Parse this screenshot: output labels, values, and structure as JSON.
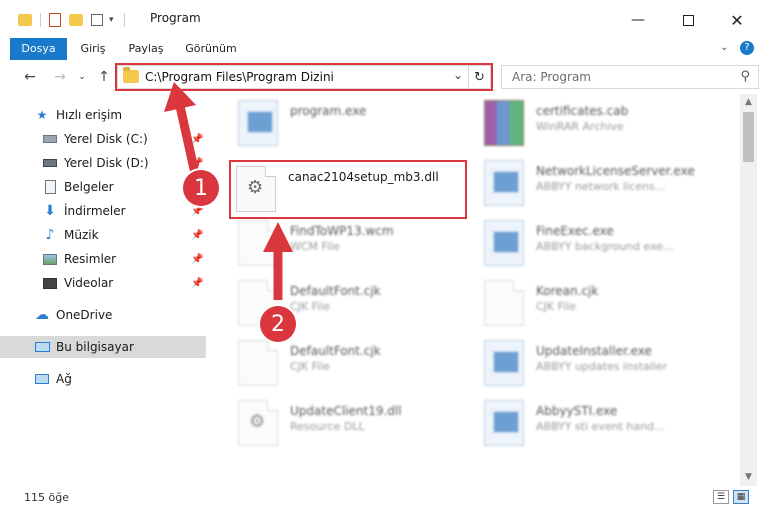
{
  "window": {
    "title": "Program",
    "minimize_icon": "minimize-icon",
    "maximize_icon": "maximize-icon",
    "close_icon": "close-icon"
  },
  "ribbon": {
    "tabs": [
      {
        "label": "Dosya",
        "active": true
      },
      {
        "label": "Giriş"
      },
      {
        "label": "Paylaş"
      },
      {
        "label": "Görünüm"
      }
    ]
  },
  "address": {
    "path": "C:\\Program Files\\Program Dizini"
  },
  "search": {
    "placeholder": "Ara: Program"
  },
  "sidebar": {
    "items": [
      {
        "label": "Hızlı erişim",
        "icon": "star-icon"
      },
      {
        "label": "Yerel Disk (C:)",
        "icon": "drive-icon",
        "pinned": true
      },
      {
        "label": "Yerel Disk (D:)",
        "icon": "drive-icon",
        "pinned": true
      },
      {
        "label": "Belgeler",
        "icon": "documents-icon",
        "pinned": true
      },
      {
        "label": "İndirmeler",
        "icon": "download-icon",
        "pinned": true
      },
      {
        "label": "Müzik",
        "icon": "music-icon",
        "pinned": true
      },
      {
        "label": "Resimler",
        "icon": "pictures-icon",
        "pinned": true
      },
      {
        "label": "Videolar",
        "icon": "video-icon",
        "pinned": true
      },
      {
        "label": "OneDrive",
        "icon": "cloud-icon"
      },
      {
        "label": "Bu bilgisayar",
        "icon": "computer-icon",
        "selected": true
      },
      {
        "label": "Ağ",
        "icon": "network-icon"
      }
    ]
  },
  "files": [
    {
      "name": "program.exe",
      "type": "",
      "kind": "exe"
    },
    {
      "name": "certificates.cab",
      "type": "WinRAR Archive",
      "kind": "rar"
    },
    {
      "name": "canac2104setup_mb3.dll",
      "type": "",
      "kind": "dll"
    },
    {
      "name": "NetworkLicenseServer.exe",
      "type": "ABBYY network licens...",
      "kind": "exe"
    },
    {
      "name": "FindToWP13.wcm",
      "type": "WCM File",
      "kind": "txt"
    },
    {
      "name": "FineExec.exe",
      "type": "ABBYY background exe...",
      "kind": "exe"
    },
    {
      "name": "DefaultFont.cjk",
      "type": "CJK File",
      "kind": "txt"
    },
    {
      "name": "Korean.cjk",
      "type": "CJK File",
      "kind": "txt"
    },
    {
      "name": "DefaultFont.cjk",
      "type": "CJK File",
      "kind": "txt"
    },
    {
      "name": "UpdateInstaller.exe",
      "type": "ABBYY updates installer",
      "kind": "exe"
    },
    {
      "name": "UpdateClient19.dll",
      "type": "Resource DLL",
      "kind": "dll"
    },
    {
      "name": "AbbyySTI.exe",
      "type": "ABBYY sti event hand...",
      "kind": "exe"
    }
  ],
  "annotations": {
    "badge1": "1",
    "badge2": "2",
    "accent": "#d9363e"
  },
  "status": {
    "count": "115 öğe"
  }
}
